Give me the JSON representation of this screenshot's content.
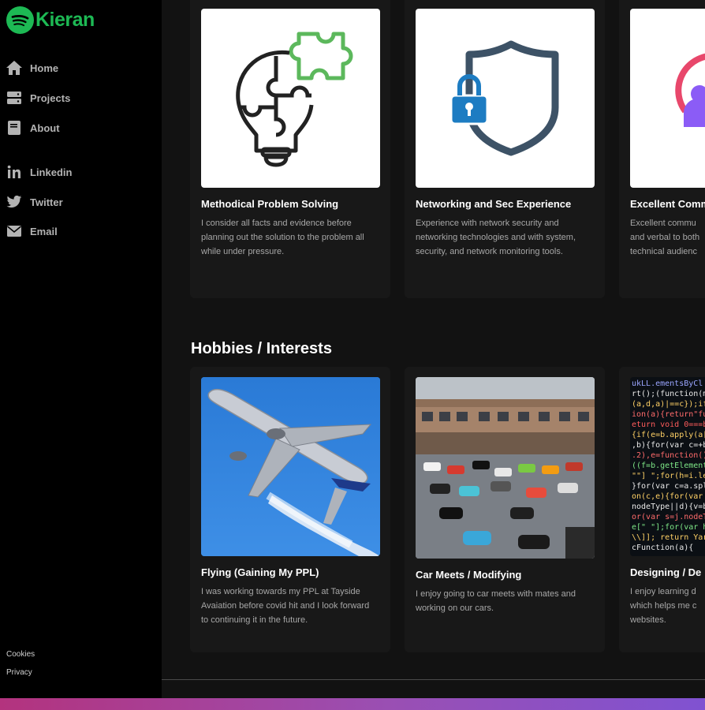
{
  "brand": {
    "name": "Kieran"
  },
  "sidebar": {
    "nav": [
      {
        "label": "Home",
        "icon": "home-icon"
      },
      {
        "label": "Projects",
        "icon": "projects-icon"
      },
      {
        "label": "About",
        "icon": "book-icon"
      },
      {
        "label": "Linkedin",
        "icon": "linkedin-icon"
      },
      {
        "label": "Twitter",
        "icon": "twitter-icon"
      },
      {
        "label": "Email",
        "icon": "email-icon"
      }
    ],
    "footer": {
      "cookies": "Cookies",
      "privacy": "Privacy"
    }
  },
  "skills": [
    {
      "title": "Methodical Problem Solving",
      "description": "I consider all facts and evidence before planning out the solution to the problem all while under pressure.",
      "icon": "puzzle-lightbulb-icon"
    },
    {
      "title": "Networking and Sec Experience",
      "description": "Experience with network security and networking technologies and with system, security, and network monitoring tools.",
      "icon": "shield-lock-icon"
    },
    {
      "title": "Excellent Comm",
      "description": "Excellent commu and verbal to both technical audienc",
      "icon": "person-speech-icon"
    }
  ],
  "hobbies": {
    "heading": "Hobbies / Interests",
    "items": [
      {
        "title": "Flying (Gaining My PPL)",
        "description": "I was working towards my PPL at Tayside Avaiation before covid hit and I look forward to continuing it in the future.",
        "image": "airplane-photo"
      },
      {
        "title": "Car Meets / Modifying",
        "description": "I enjoy going to car meets with mates and working on our cars.",
        "image": "car-meet-photo"
      },
      {
        "title": "Designing / De",
        "description": "I enjoy learning d which helps me c websites.",
        "image": "code-screenshot"
      }
    ]
  },
  "colors": {
    "accent": "#1db954",
    "sidebar_bg": "#000000",
    "main_bg": "#121212",
    "card_bg": "#181818"
  }
}
